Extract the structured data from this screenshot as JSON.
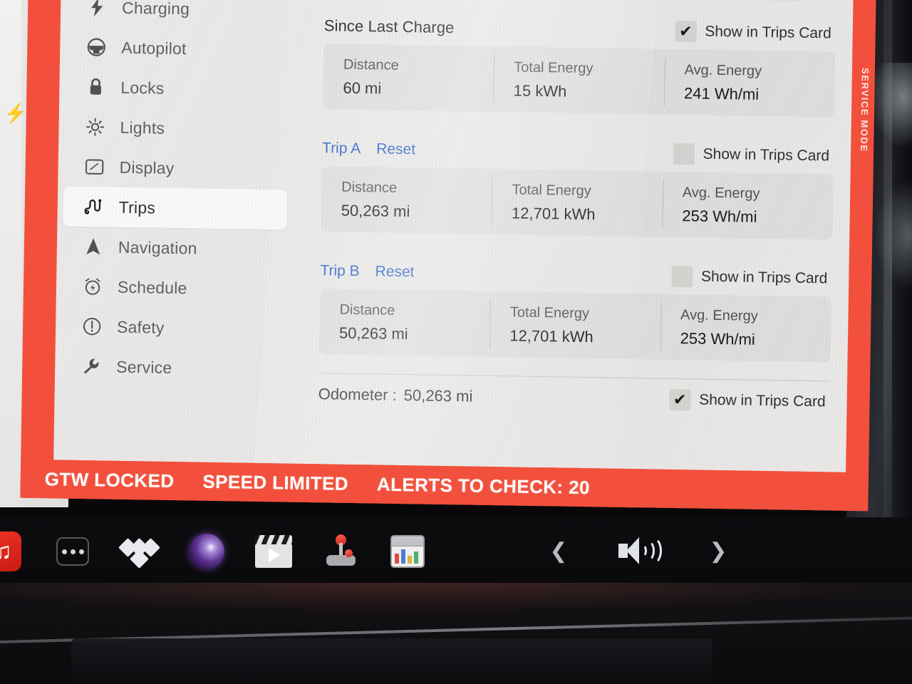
{
  "service_mode": {
    "label": "SERVICE MODE",
    "frame_color": "#f2503c"
  },
  "sidebar": {
    "items": [
      {
        "id": "charging",
        "label": "Charging",
        "icon": "bolt-icon",
        "active": false
      },
      {
        "id": "autopilot",
        "label": "Autopilot",
        "icon": "steering-wheel-icon",
        "active": false
      },
      {
        "id": "locks",
        "label": "Locks",
        "icon": "lock-icon",
        "active": false
      },
      {
        "id": "lights",
        "label": "Lights",
        "icon": "sun-icon",
        "active": false
      },
      {
        "id": "display",
        "label": "Display",
        "icon": "display-icon",
        "active": false
      },
      {
        "id": "trips",
        "label": "Trips",
        "icon": "winding-road-icon",
        "active": true
      },
      {
        "id": "navigation",
        "label": "Navigation",
        "icon": "navigation-arrow-icon",
        "active": false
      },
      {
        "id": "schedule",
        "label": "Schedule",
        "icon": "alarm-clock-icon",
        "active": false
      },
      {
        "id": "safety",
        "label": "Safety",
        "icon": "exclamation-circle-icon",
        "active": false
      },
      {
        "id": "service",
        "label": "Service",
        "icon": "wrench-icon",
        "active": false
      }
    ]
  },
  "main": {
    "stat_labels": {
      "distance": "Distance",
      "total_energy": "Total Energy",
      "avg_energy": "Avg. Energy"
    },
    "show_in_trips_card_label": "Show in Trips Card",
    "sections": [
      {
        "id": "since-last-charge",
        "title": "Since Last Charge",
        "reset_label": null,
        "show_in_trips_card": true,
        "distance": "60 mi",
        "total_energy": "15 kWh",
        "avg_energy": "241 Wh/mi"
      },
      {
        "id": "trip-a",
        "title": "Trip A",
        "reset_label": "Reset",
        "show_in_trips_card": false,
        "distance": "50,263 mi",
        "total_energy": "12,701 kWh",
        "avg_energy": "253 Wh/mi"
      },
      {
        "id": "trip-b",
        "title": "Trip B",
        "reset_label": "Reset",
        "show_in_trips_card": false,
        "distance": "50,263 mi",
        "total_energy": "12,701 kWh",
        "avg_energy": "253 Wh/mi"
      }
    ],
    "odometer": {
      "label": "Odometer :",
      "value": "50,263 mi",
      "show_in_trips_card": true
    }
  },
  "alert_bar": {
    "messages": [
      "GTW LOCKED",
      "SPEED LIMITED",
      "ALERTS TO CHECK: 20"
    ],
    "background_color": "#f2503c"
  },
  "taskbar": {
    "items": [
      {
        "id": "media-app",
        "icon": "red-media-app-icon"
      },
      {
        "id": "more",
        "icon": "three-dots-icon"
      },
      {
        "id": "tidal",
        "icon": "tidal-logo-icon"
      },
      {
        "id": "theater",
        "icon": "camera-lens-icon"
      },
      {
        "id": "video",
        "icon": "clapperboard-icon"
      },
      {
        "id": "arcade",
        "icon": "joystick-icon"
      },
      {
        "id": "toybox",
        "icon": "app-grid-icon"
      }
    ],
    "prev_icon": "chevron-left-icon",
    "volume_icon": "volume-speaker-icon",
    "next_icon": "chevron-right-icon"
  },
  "colors": {
    "link_blue": "#2a5ec9",
    "alert_red": "#f2503c",
    "screen_bg": "#e9e8e6"
  }
}
